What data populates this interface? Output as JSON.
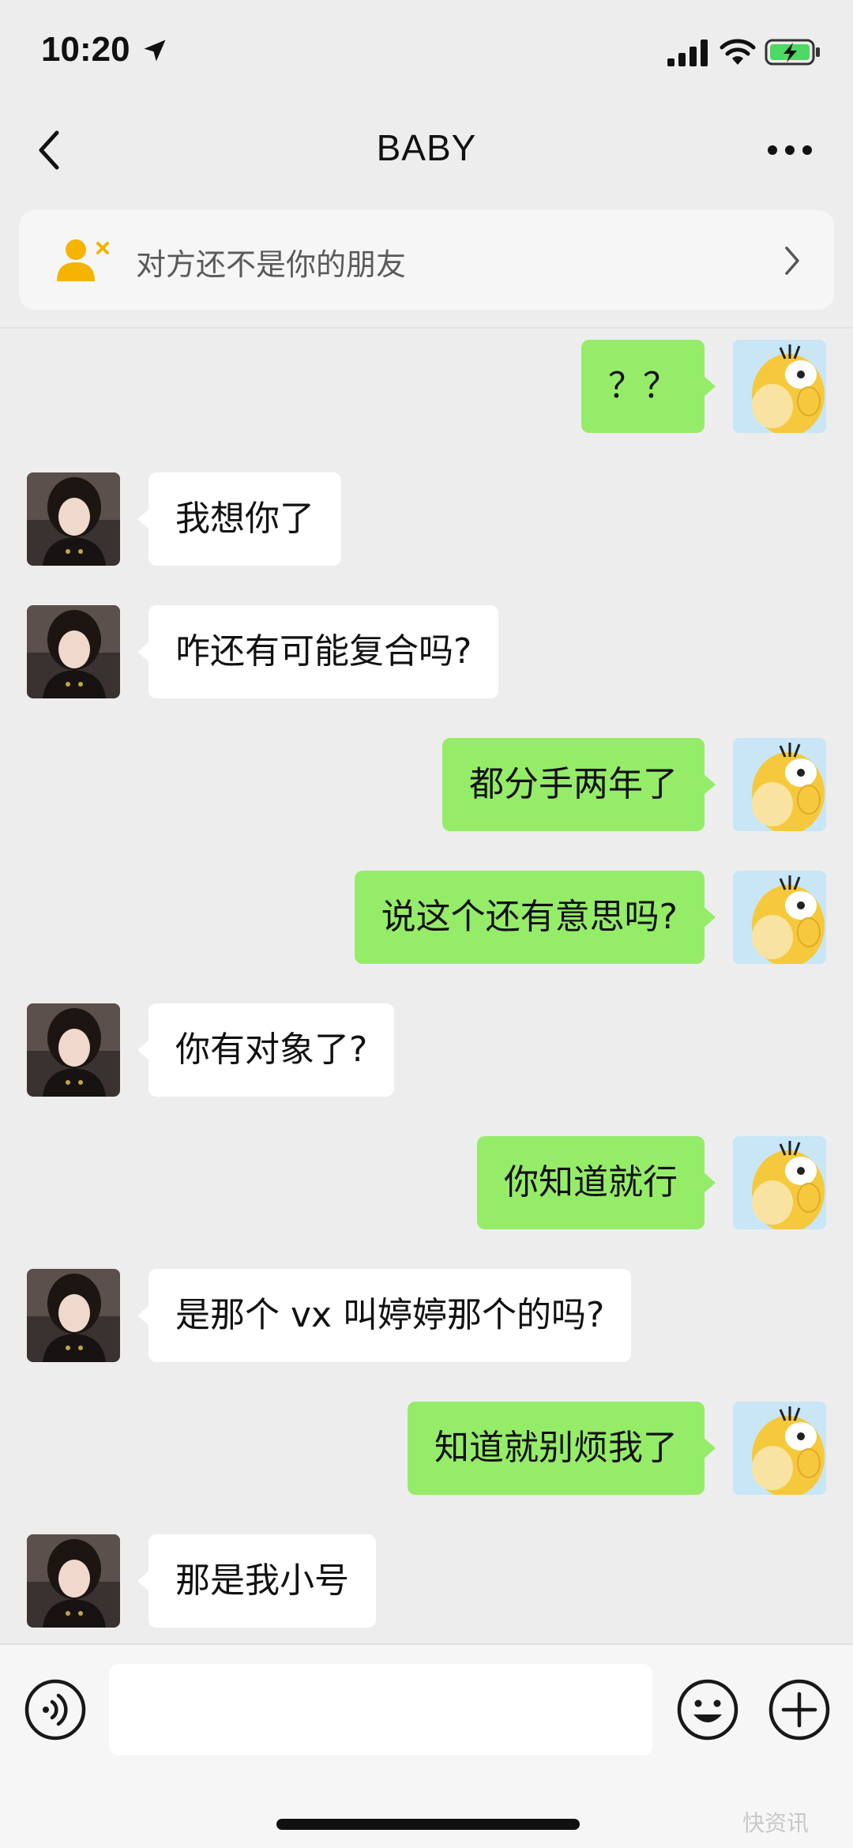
{
  "status_bar": {
    "time": "10:20"
  },
  "nav": {
    "title": "BABY"
  },
  "banner": {
    "text": "对方还不是你的朋友"
  },
  "messages": [
    {
      "side": "out",
      "text": "？？"
    },
    {
      "side": "in",
      "text": "我想你了"
    },
    {
      "side": "in",
      "text": "咋还有可能复合吗?"
    },
    {
      "side": "out",
      "text": "都分手两年了"
    },
    {
      "side": "out",
      "text": "说这个还有意思吗?"
    },
    {
      "side": "in",
      "text": "你有对象了?"
    },
    {
      "side": "out",
      "text": "你知道就行"
    },
    {
      "side": "in",
      "text": "是那个 vx 叫婷婷那个的吗?"
    },
    {
      "side": "out",
      "text": "知道就别烦我了"
    },
    {
      "side": "in",
      "text": "那是我小号"
    }
  ],
  "input": {
    "value": "",
    "placeholder": ""
  },
  "watermark": "快资讯",
  "colors": {
    "outgoing_bubble": "#95ec69",
    "incoming_bubble": "#ffffff",
    "background": "#ededed"
  },
  "icons": {
    "back": "chevron-left-icon",
    "more": "more-dots-icon",
    "stranger": "person-x-icon",
    "voice": "voice-icon",
    "emoji": "emoji-icon",
    "plus": "plus-icon"
  }
}
